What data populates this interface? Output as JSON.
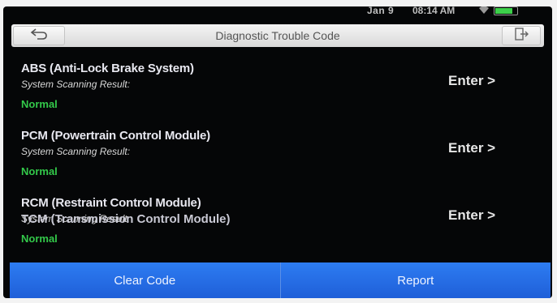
{
  "statusbar": {
    "date": "Jan 9",
    "time": "08:14 AM",
    "wifi_icon": "wifi-icon",
    "battery_level_fraction": 0.75,
    "battery_color": "#3cd04a"
  },
  "header": {
    "title": "Diagnostic Trouble Code",
    "back_icon": "back-arrow-icon",
    "exit_icon": "exit-icon"
  },
  "systems": [
    {
      "name": "ABS (Anti-Lock Brake System)",
      "subtitle": "System Scanning Result:",
      "status": "Normal",
      "action": "Enter >"
    },
    {
      "name": "PCM (Powertrain Control Module)",
      "subtitle": "System Scanning Result:",
      "status": "Normal",
      "action": "Enter >"
    },
    {
      "name": "RCM (Restraint Control Module)",
      "subtitle": "System Scanning Result:",
      "status": "Normal",
      "action": "Enter >"
    }
  ],
  "partial_item": "TCM (Transmission Control Module)",
  "footer": {
    "clear_label": "Clear Code",
    "report_label": "Report"
  },
  "colors": {
    "status_normal": "#33c94a",
    "footer_button": "#2d7cf2"
  }
}
